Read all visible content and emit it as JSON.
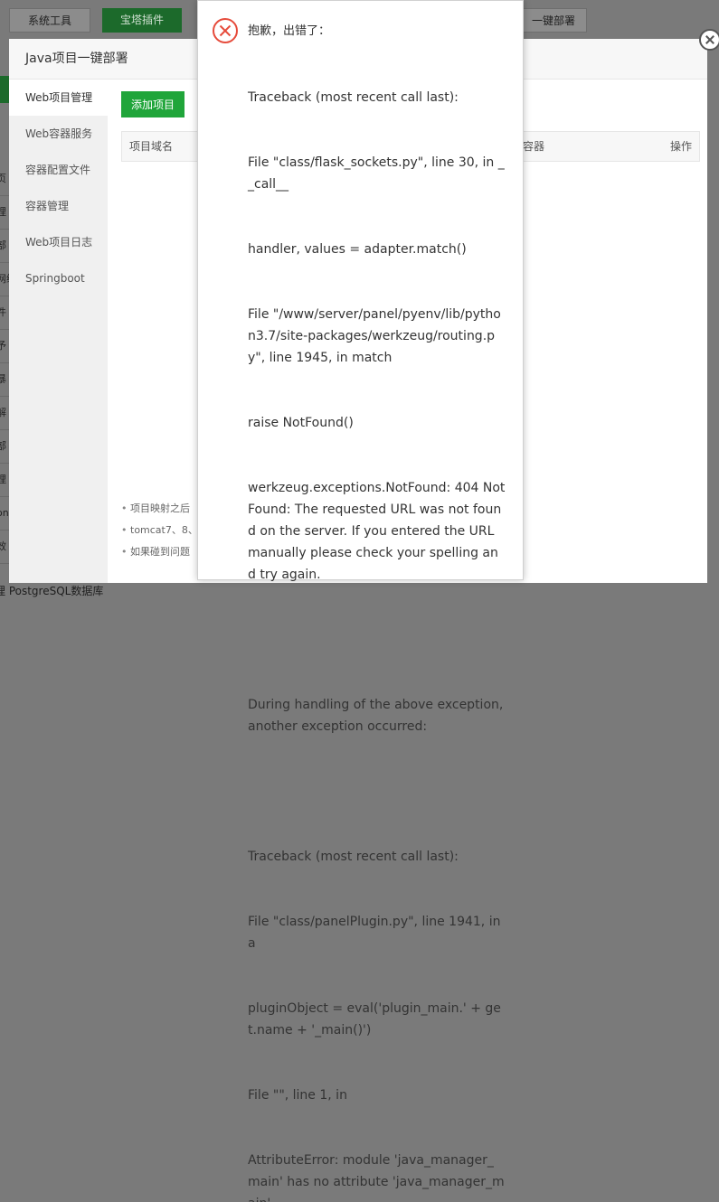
{
  "background": {
    "tabs": [
      "系统工具",
      "宝塔插件",
      "一键部署"
    ],
    "sidebar_fragments": [
      "页",
      "理",
      "部",
      "网络",
      "件",
      "予",
      "暴",
      "解",
      "部",
      "理",
      "on",
      "效"
    ],
    "bottom_text": "理 PostgreSQL数据库"
  },
  "dialog": {
    "title": "Java项目一键部署",
    "sidebar": [
      {
        "label": "Web项目管理",
        "active": true
      },
      {
        "label": "Web容器服务",
        "active": false
      },
      {
        "label": "容器配置文件",
        "active": false
      },
      {
        "label": "容器管理",
        "active": false
      },
      {
        "label": "Web项目日志",
        "active": false
      },
      {
        "label": "Springboot",
        "active": false
      }
    ],
    "add_button": "添加项目",
    "table_headers": [
      "项目域名",
      "容器",
      "操作"
    ],
    "notes": [
      "项目映射之后",
      "tomcat7、8、",
      "如果碰到问题"
    ]
  },
  "error": {
    "title": "抱歉，出错了：",
    "lines": [
      "Traceback (most recent call last):",
      "File \"class/flask_sockets.py\", line 30, in __call__",
      "handler, values = adapter.match()",
      "File \"/www/server/panel/pyenv/lib/python3.7/site-packages/werkzeug/routing.py\", line 1945, in match",
      "raise NotFound()",
      "werkzeug.exceptions.NotFound: 404 Not Found: The requested URL was not found on the server. If you entered the URL manually please check your spelling and try again.",
      "",
      "During handling of the above exception, another exception occurred:",
      "",
      "Traceback (most recent call last):",
      "File \"class/panelPlugin.py\", line 1941, in a",
      "pluginObject = eval('plugin_main.' + get.name + '_main()')",
      "File \"\", line 1, in",
      "AttributeError: module 'java_manager_main' has no attribute 'java_manager_main'"
    ],
    "icon_color": "#e64b3b"
  },
  "colors": {
    "accent": "#20a53a",
    "error": "#e64b3b"
  }
}
